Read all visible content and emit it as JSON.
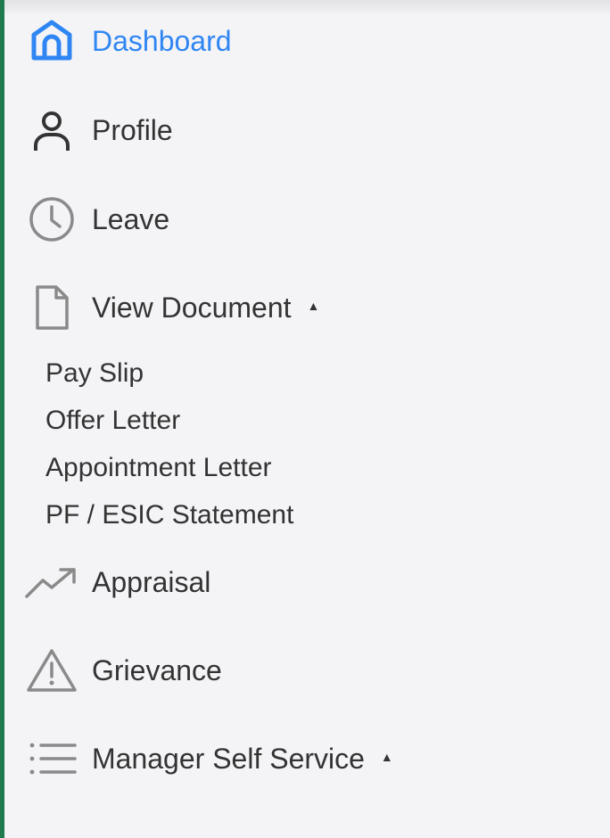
{
  "colors": {
    "accent": "#2f86f3",
    "text": "#333333",
    "icon_gray": "#8a8a8a",
    "left_border": "#1f7a4d",
    "background": "#f4f4f7"
  },
  "sidebar": {
    "items": [
      {
        "label": "Dashboard",
        "icon": "home-icon",
        "active": true
      },
      {
        "label": "Profile",
        "icon": "user-icon"
      },
      {
        "label": "Leave",
        "icon": "clock-icon"
      },
      {
        "label": "View Document",
        "icon": "document-icon",
        "expanded": true,
        "caret": "▲"
      },
      {
        "label": "Appraisal",
        "icon": "trend-up-icon"
      },
      {
        "label": "Grievance",
        "icon": "warning-icon"
      },
      {
        "label": "Manager Self Service",
        "icon": "list-icon",
        "expanded": true,
        "caret": "▲"
      }
    ],
    "documents": [
      "Pay Slip",
      "Offer Letter",
      "Appointment Letter",
      "PF / ESIC Statement"
    ]
  }
}
